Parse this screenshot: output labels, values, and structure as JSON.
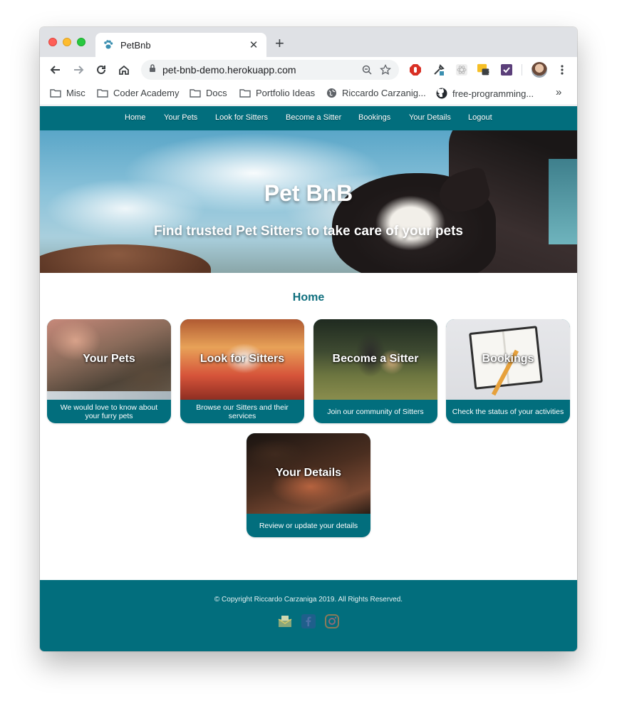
{
  "browser": {
    "tab_title": "PetBnb",
    "url": "pet-bnb-demo.herokuapp.com",
    "extension_badge": "1",
    "bookmarks": [
      {
        "label": "Misc",
        "type": "folder"
      },
      {
        "label": "Coder Academy",
        "type": "folder"
      },
      {
        "label": "Docs",
        "type": "folder"
      },
      {
        "label": "Portfolio Ideas",
        "type": "folder"
      },
      {
        "label": "Riccardo Carzanig...",
        "type": "globe"
      },
      {
        "label": "free-programming...",
        "type": "github"
      }
    ],
    "bookmarks_overflow": "»"
  },
  "nav": {
    "items": [
      "Home",
      "Your Pets",
      "Look for Sitters",
      "Become a Sitter",
      "Bookings",
      "Your Details",
      "Logout"
    ]
  },
  "hero": {
    "title": "Pet BnB",
    "subtitle": "Find trusted Pet Sitters to take care of your pets"
  },
  "home": {
    "title": "Home",
    "cards": [
      {
        "title": "Your Pets",
        "caption": "We would love to know about your furry pets"
      },
      {
        "title": "Look for Sitters",
        "caption": "Browse our Sitters and their services"
      },
      {
        "title": "Become a Sitter",
        "caption": "Join our community of Sitters"
      },
      {
        "title": "Bookings",
        "caption": "Check the status of your activities"
      },
      {
        "title": "Your Details",
        "caption": "Review or update your details"
      }
    ]
  },
  "footer": {
    "copyright": "© Copyright Riccardo Carzaniga 2019. All Rights Reserved.",
    "social_icons": [
      "mail-icon",
      "facebook-icon",
      "instagram-icon"
    ]
  },
  "colors": {
    "brand_teal": "#026e7d",
    "title_teal": "#0e6e7d"
  }
}
